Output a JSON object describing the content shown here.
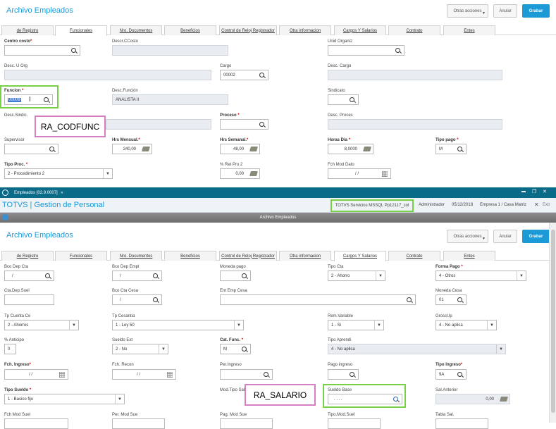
{
  "top": {
    "title": "Archivo Empleados",
    "btn_otras": "Otras acciones",
    "btn_anular": "Anular",
    "btn_grabar": "Grabar",
    "tabs": [
      "de Registro",
      "Funcionales",
      "Nro. Documentos",
      "Beneficios",
      "Control de Reloj Registrador",
      "Otra informacion",
      "Cargos Y Salarios",
      "Contrato",
      "Entes"
    ],
    "fields": {
      "centro_costo": "Centro costo",
      "desc_ccosto": "Descr.CCosto",
      "unid_organiz": "Unid Organiz",
      "desc_u_org": "Desc. U Org",
      "cargo": "Cargo",
      "cargo_val": "00002",
      "desc_cargo": "Desc. Cargo",
      "funcion": "Funcion",
      "funcion_val": "00009",
      "desc_funcion": "Desc.Función",
      "desc_funcion_val": "ANALISTA II",
      "sindicato": "Sindicato",
      "desc_sindic": "Desc.Sindic.",
      "proceso": "Proceso",
      "desc_proces": "Desc. Proces",
      "supervisor": "Supervisor",
      "hrs_mensual": "Hrs Mensual.",
      "hrs_mensual_val": "240,00",
      "hrs_semanal": "Hrs Semanal.",
      "hrs_semanal_val": "48,00",
      "horas_dia": "Horas Dia",
      "horas_dia_val": "8,0000",
      "tipo_pago": "Tipo pago",
      "tipo_pago_val": "M",
      "tipo_proc": "Tipo Proc.",
      "tipo_proc_val": "2 - Procedimiento 2",
      "ret_pro2": "% Ret Pro 2",
      "ret_pro2_val": "0,00",
      "fch_mod_dato": "Fch Mod Dato",
      "fch_mod_dato_val": "/ /"
    },
    "callout": "RA_CODFUNC"
  },
  "taskbar": {
    "tab_label": "Empleados [02.9.0007]",
    "tab_close": "✕",
    "win_ctrl": [
      "▬",
      "❐",
      "✕"
    ]
  },
  "totvs": {
    "brand": "TOTVS | Gestion de Personal",
    "server": "TOTVS Servicios MSSQL Pp12117_col",
    "user": "Administrador",
    "date": "05/12/2018",
    "company": "Empresa 1 / Casa Matriz",
    "exit": "Exit",
    "exit_icon": "✕"
  },
  "window_title": "Archivo Empleados",
  "bottom": {
    "title": "Archivo Empleados",
    "btn_otras": "Otras acciones",
    "btn_anular": "Anular",
    "btn_grabar": "Grabar",
    "tabs": [
      "de Registro",
      "Funcionales",
      "Nro. Documentos",
      "Beneficios",
      "Control de Reloj Registrador",
      "Otra informacion",
      "Cargos Y Salarios",
      "Contrato",
      "Entes"
    ],
    "fields": {
      "bco_dep_cta": "Bco Dep Cta",
      "bco_dep_cta_val": "/",
      "bco_dep_empl": "Bco Dep Empl",
      "bco_dep_empl_val": "/",
      "moneda_pago": "Moneda pago",
      "tipo_cta": "Tipo Cta",
      "tipo_cta_val": "2 - Ahorro",
      "forma_pago": "Forma Pago",
      "forma_pago_val": "4 - Otros",
      "cta_dep_suel": "Cta.Dep.Suel",
      "bco_cta_cesa": "Bco Cta Cesa",
      "bco_cta_cesa_val": "/",
      "ent_emp_cesa": "Ent Emp Cesa",
      "moneda_cesa": "Moneda Cesa",
      "moneda_cesa_val": "01",
      "tp_cuenta_ce": "Tp Cuenta Ce",
      "tp_cuenta_ce_val": "2 - Ahorros",
      "tp_cesantia": "Tp Cesantia",
      "tp_cesantia_val": "1 - Ley 50",
      "rem_variable": "Rem.Variable",
      "rem_variable_val": "1 - Si",
      "grossup": "GrossUp",
      "grossup_val": "4 - No aplica",
      "anticipo": "% Anticipo",
      "anticipo_val": "0",
      "sueldo_ext": "Sueldo Ext",
      "sueldo_ext_val": "2 - No",
      "cat_func": "Cat. Func.",
      "cat_func_val": "M",
      "tipo_aprendi": "Tipo Aprendi",
      "tipo_aprendi_val": "4 - No aplica",
      "fch_ingreso": "Fch. Ingreso",
      "fch_ingreso_val": "/ /",
      "fch_recon": "Fch. Recon",
      "fch_recon_val": "/ /",
      "per_ingreso": "Per.Ingreso",
      "pago_ingreso": "Pago ingreso",
      "tipo_ingreso": "Tipo Ingreso",
      "tipo_ingreso_val": "9A",
      "tipo_sueldo": "Tipo Sueldo",
      "tipo_sueldo_val": "1 - Basico fijo",
      "mod_tipo_sal": "Mod.Tipo Sal",
      "sueldo_base": "Sueldo Base",
      "sueldo_base_val": ". . . .",
      "sal_anterior": "Sal.Anterior",
      "sal_anterior_val": "0,00",
      "fch_mod_suel": "Fch Mod Suel",
      "per_mod_sue": "Per. Mod Sue",
      "pag_mod_sue": "Pag. Mod Sue",
      "tipo_mod_suel": "Tipo.Mod.Suel",
      "tabla_sal": "Tabla Sal."
    },
    "callout": "RA_SALARIO"
  }
}
